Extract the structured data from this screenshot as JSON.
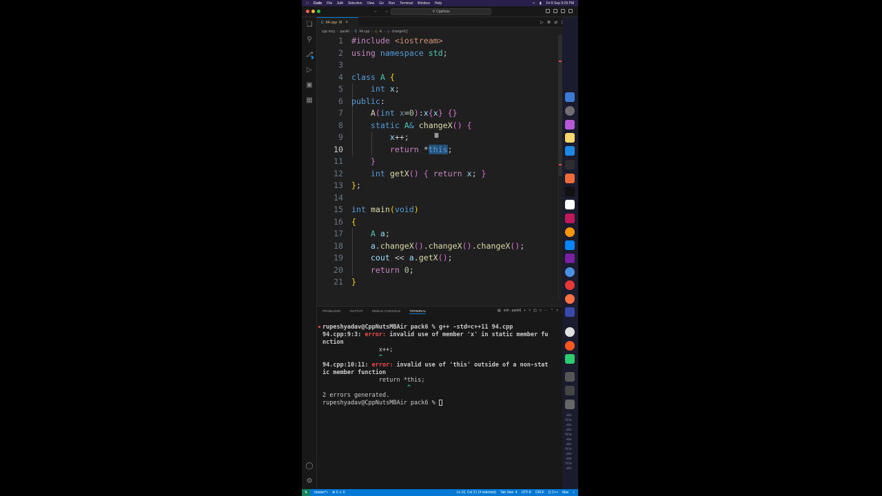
{
  "menubar": {
    "app": "Code",
    "items": [
      "File",
      "Edit",
      "Selection",
      "View",
      "Go",
      "Run",
      "Terminal",
      "Window",
      "Help"
    ],
    "clock": "Fri 8 Sep 9:29 PM"
  },
  "titlebar": {
    "search": "CppNuts"
  },
  "tab": {
    "label": "94.cpp",
    "modified": "M",
    "icon": "C"
  },
  "breadcrumb": [
    "cpp mcq",
    "pack6",
    "94.cpp",
    "A",
    "changeX()"
  ],
  "editor": {
    "line_numbers": [
      "1",
      "2",
      "3",
      "4",
      "5",
      "6",
      "7",
      "8",
      "9",
      "10",
      "11",
      "12",
      "13",
      "14",
      "15",
      "16",
      "17",
      "18",
      "19",
      "20",
      "21"
    ],
    "active_line": "10",
    "selected_text": "this"
  },
  "panel": {
    "tabs": [
      "PROBLEMS",
      "OUTPUT",
      "DEBUG CONSOLE",
      "TERMINAL"
    ],
    "active_tab": "TERMINAL",
    "shell": "zsh - pack6",
    "terminal_lines": [
      "rupeshyadav@CppNutsMBAir pack6 % g++ -std=c++11 94.cpp",
      "94.cpp:9:3: error: invalid use of member 'x' in static member fu",
      "nction",
      "                x++;",
      "                ^",
      "94.cpp:10:11: error: invalid use of 'this' outside of a non-stat",
      "ic member function",
      "                return *this;",
      "                        ^",
      "2 errors generated.",
      "rupeshyadav@CppNutsMBAir pack6 % "
    ]
  },
  "statusbar": {
    "branch": "master*+",
    "problems": "⊗ 0 ⚠ 0",
    "cursor": "Ln 10, Col 21 (4 selected)",
    "tab_size": "Tab Size: 4",
    "encoding": "UTF-8",
    "eol": "CRLF",
    "language": "C++",
    "platform": "Mac"
  },
  "colors": {
    "accent": "#0078d4",
    "error": "#f14c4c",
    "keyword": "#569cd6",
    "type": "#4ec9b0",
    "function": "#dcdcaa"
  },
  "dock": {
    "file_labels": [
      ".dis",
      "file",
      ".dis",
      ".dis",
      "file",
      ".dis",
      ".dis",
      "file",
      ".dis",
      ".dis",
      "file",
      ".dis"
    ]
  }
}
